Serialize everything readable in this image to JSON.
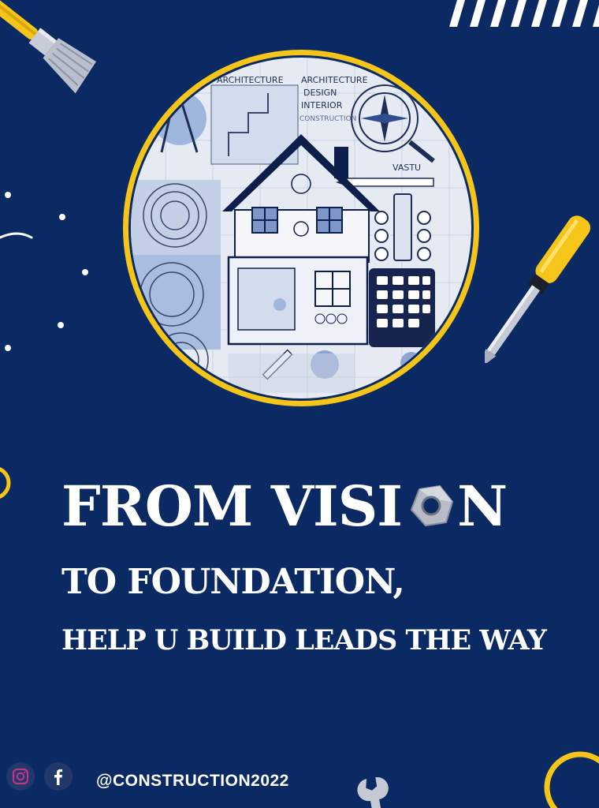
{
  "poster": {
    "headline_line1": "FROM VISI",
    "headline_line1_end": "N",
    "headline_line2": "TO FOUNDATION,",
    "headline_line3": "HELP U BUILD LEADS THE WAY",
    "handle": "@CONSTRUCTION2022"
  },
  "illustration": {
    "label_architecture_left": "ARCHITECTURE",
    "label_architecture_right": "ARCHITECTURE",
    "label_design": "DESIGN",
    "label_interior": "INTERIOR",
    "label_construction": "CONSTRUCTION",
    "label_vastu": "VASTU"
  },
  "icons": [
    "paintbrush-icon",
    "screwdriver-icon",
    "hex-nut-icon",
    "wrench-icon",
    "instagram-icon",
    "facebook-icon"
  ],
  "colors": {
    "background": "#0b2a63",
    "accent_yellow": "#f5c519",
    "text": "#ffffff"
  }
}
